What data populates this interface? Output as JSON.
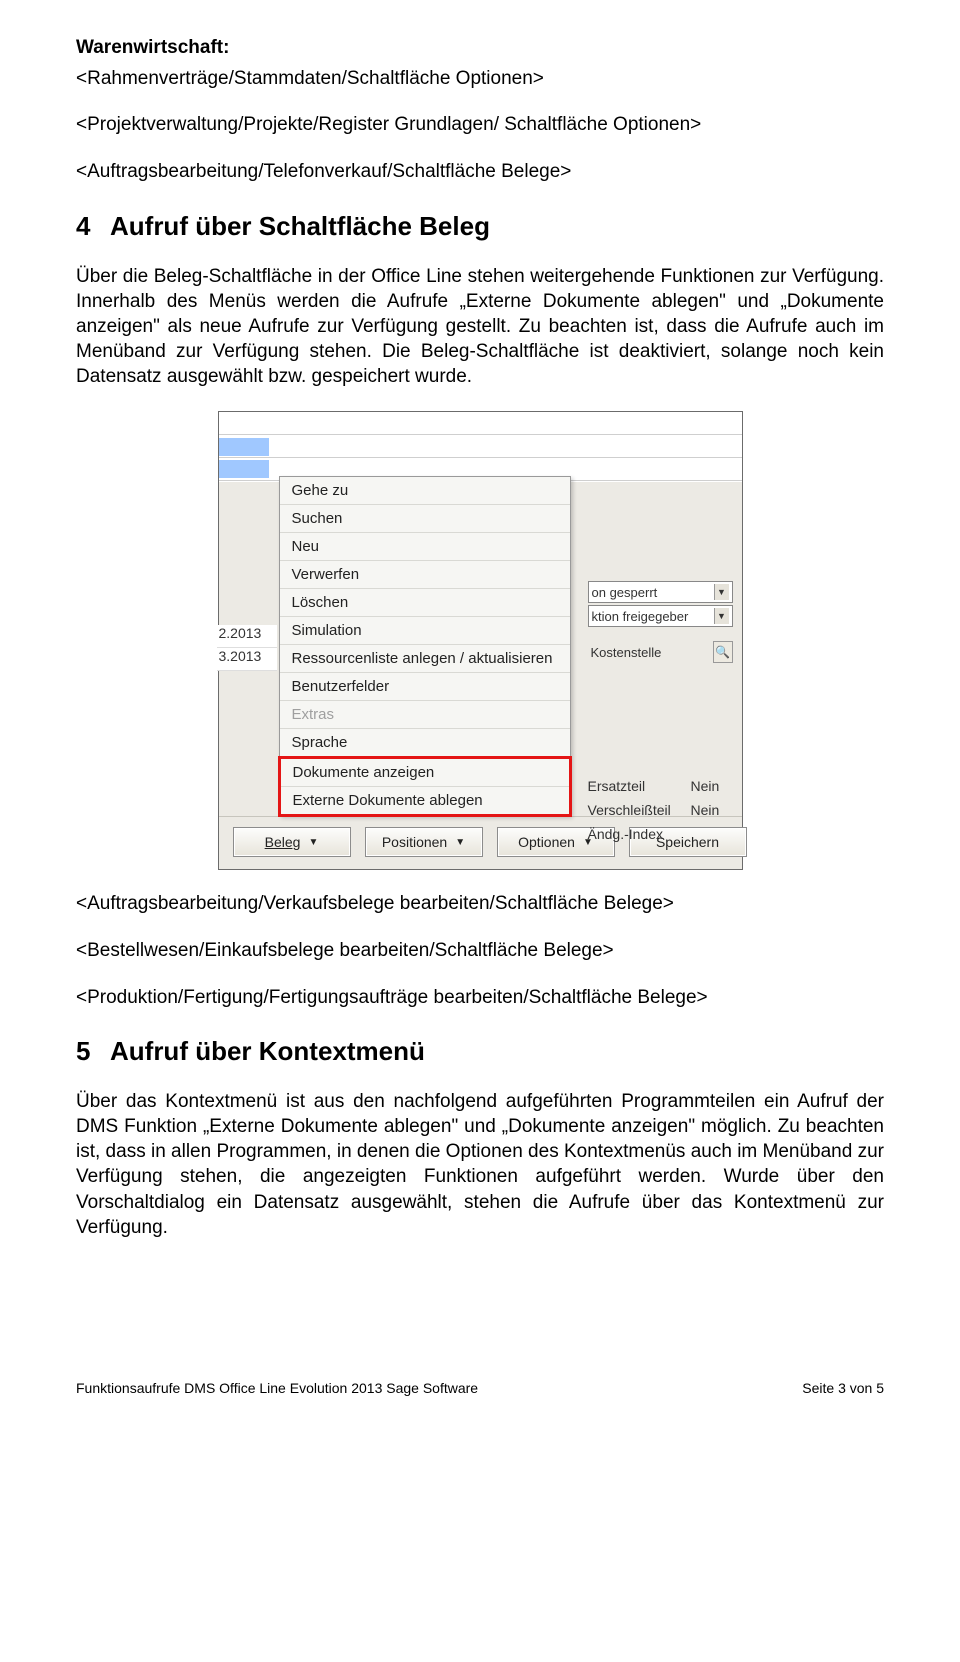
{
  "intro": {
    "ww_heading": "Warenwirtschaft:",
    "line1": "<Rahmenverträge/Stammdaten/Schaltfläche Optionen>",
    "line2": "<Projektverwaltung/Projekte/Register Grundlagen/ Schaltfläche Optionen>",
    "line3": "<Auftragsbearbeitung/Telefonverkauf/Schaltfläche Belege>"
  },
  "sec4": {
    "num": "4",
    "title": "Aufruf über Schaltfläche Beleg",
    "body": "Über die Beleg-Schaltfläche in der Office Line stehen weitergehende Funktionen zur Verfügung. Innerhalb des Menüs werden die Aufrufe „Externe Dokumente ablegen\" und „Dokumente anzeigen\" als neue Aufrufe zur Verfügung gestellt. Zu beachten ist, dass die Aufrufe auch im Menüband zur Verfügung stehen. Die Beleg-Schaltfläche ist deaktiviert, solange noch kein Datensatz ausgewählt bzw. gespeichert wurde."
  },
  "screenshot": {
    "menu_items": [
      {
        "label": "Gehe zu",
        "disabled": false
      },
      {
        "label": "Suchen",
        "disabled": false
      },
      {
        "label": "Neu",
        "disabled": false
      },
      {
        "label": "Verwerfen",
        "disabled": false
      },
      {
        "label": "Löschen",
        "disabled": false
      },
      {
        "label": "Simulation",
        "disabled": false
      },
      {
        "label": "Ressourcenliste anlegen / aktualisieren",
        "disabled": false
      },
      {
        "label": "Benutzerfelder",
        "disabled": false
      },
      {
        "label": "Extras",
        "disabled": true
      },
      {
        "label": "Sprache",
        "disabled": false
      }
    ],
    "menu_hilite": [
      {
        "label": "Dokumente anzeigen"
      },
      {
        "label": "Externe Dokumente ablegen"
      }
    ],
    "right": {
      "dd1": "on gesperrt",
      "dd2": "ktion freigegeber",
      "kost_label": "Kostenstelle",
      "ersatz_label": "Ersatzteil",
      "ersatz_val": "Nein",
      "versch_label": "Verschleißteil",
      "versch_val": "Nein",
      "andg_label": "Ändg.-Index"
    },
    "dates": {
      "d1": "2.2013",
      "d2": "3.2013"
    },
    "buttons": {
      "beleg": "Beleg",
      "positionen": "Positionen",
      "optionen": "Optionen",
      "speichern": "Speichern"
    }
  },
  "mid_paths": {
    "p1": "<Auftragsbearbeitung/Verkaufsbelege  bearbeiten/Schaltfläche Belege>",
    "p2": "<Bestellwesen/Einkaufsbelege bearbeiten/Schaltfläche Belege>",
    "p3": "<Produktion/Fertigung/Fertigungsaufträge bearbeiten/Schaltfläche Belege>"
  },
  "sec5": {
    "num": "5",
    "title": "Aufruf über Kontextmenü",
    "body": "Über das Kontextmenü ist aus den nachfolgend aufgeführten Programmteilen ein Aufruf der DMS Funktion „Externe Dokumente ablegen\" und „Dokumente anzeigen\" möglich. Zu beachten ist, dass in allen Programmen, in denen die Optionen des Kontextmenüs auch im Menüband zur Verfügung stehen, die angezeigten Funktionen aufgeführt werden. Wurde über den Vorschaltdialog ein Datensatz ausgewählt, stehen die Aufrufe über das Kontextmenü zur Verfügung."
  },
  "footer": {
    "left": "Funktionsaufrufe  DMS Office Line Evolution 2013 Sage Software",
    "right": "Seite  3 von 5"
  }
}
